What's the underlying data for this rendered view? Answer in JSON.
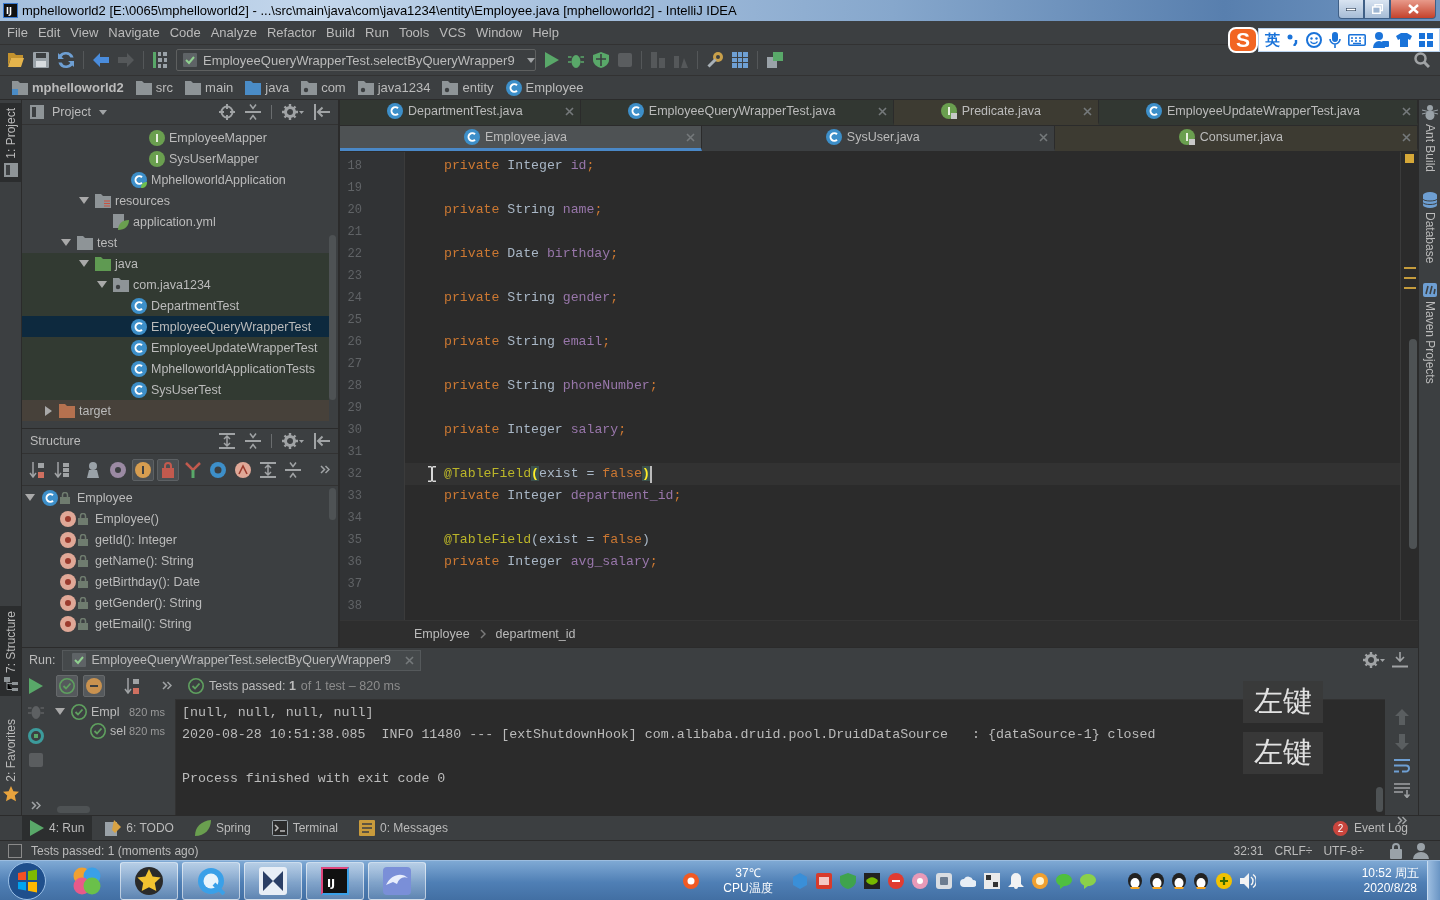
{
  "title_bar": {
    "app_icon": "IJ",
    "title": "mphelloworld2 [E:\\0065\\mphelloworld2] - ...\\src\\main\\java\\com\\java1234\\entity\\Employee.java [mphelloworld2] - IntelliJ IDEA"
  },
  "menu": [
    "File",
    "Edit",
    "View",
    "Navigate",
    "Code",
    "Analyze",
    "Refactor",
    "Build",
    "Run",
    "Tools",
    "VCS",
    "Window",
    "Help"
  ],
  "ime_bar": {
    "logo": "S",
    "mode": "英"
  },
  "toolbar": {
    "run_configuration": "EmployeeQueryWrapperTest.selectByQueryWrapper9"
  },
  "navigation_bar": [
    {
      "label": "mphelloworld2",
      "kind": "project"
    },
    {
      "label": "src",
      "kind": "folder"
    },
    {
      "label": "main",
      "kind": "folder"
    },
    {
      "label": "java",
      "kind": "source_root"
    },
    {
      "label": "com",
      "kind": "package"
    },
    {
      "label": "java1234",
      "kind": "package"
    },
    {
      "label": "entity",
      "kind": "package"
    },
    {
      "label": "Employee",
      "kind": "class"
    }
  ],
  "left_stripe": {
    "top": [
      {
        "label": "1: Project",
        "kind": "project",
        "selected": true
      }
    ],
    "bottom": [
      {
        "label": "7: Structure",
        "kind": "structure",
        "selected": true
      },
      {
        "label": "2: Favorites",
        "kind": "favorites",
        "selected": false
      }
    ]
  },
  "right_stripe": [
    {
      "label": "Ant Build",
      "kind": "ant"
    },
    {
      "label": "Database",
      "kind": "database"
    },
    {
      "label": "Maven Projects",
      "kind": "maven"
    }
  ],
  "project_panel": {
    "title": "Project",
    "tree": [
      {
        "children": [
          {
            "children": [
              {
                "children": [
                  {
                    "children": [
                      {
                        "children": [
                          {
                            "label": "EmployeeMapper",
                            "kind": "interface",
                            "selected": false
                          },
                          {
                            "label": "SysUserMapper",
                            "kind": "interface",
                            "selected": false
                          }
                        ]
                      },
                      {
                        "label": "MphelloworldApplication",
                        "kind": "spring_class",
                        "selected": false
                      }
                    ]
                  }
                ]
              },
              {
                "label": "resources",
                "kind": "resources_folder",
                "expanded": true,
                "selected": false,
                "children": [
                  {
                    "label": "application.yml",
                    "kind": "yml",
                    "selected": false
                  }
                ]
              }
            ]
          },
          {
            "label": "test",
            "kind": "folder",
            "expanded": true,
            "selected": false,
            "children": [
              {
                "label": "java",
                "kind": "test_root",
                "expanded": true,
                "selected": false,
                "children": [
                  {
                    "label": "com.java1234",
                    "kind": "package",
                    "expanded": true,
                    "selected": false,
                    "children": [
                      {
                        "label": "DepartmentTest",
                        "kind": "test_class",
                        "selected": false
                      },
                      {
                        "label": "EmployeeQueryWrapperTest",
                        "kind": "test_class",
                        "selected": true
                      },
                      {
                        "label": "EmployeeUpdateWrapperTest",
                        "kind": "test_class",
                        "selected": false
                      },
                      {
                        "label": "MphelloworldApplicationTests",
                        "kind": "test_class",
                        "selected": false
                      },
                      {
                        "label": "SysUserTest",
                        "kind": "test_class",
                        "selected": false
                      }
                    ]
                  }
                ]
              }
            ]
          }
        ]
      },
      {
        "label": "target",
        "kind": "excluded_folder",
        "expanded": false,
        "selected": false
      }
    ]
  },
  "structure_panel": {
    "title": "Structure",
    "toolbar": [
      {
        "kind": "sort_alpha",
        "pressed": false
      },
      {
        "kind": "sort_visibility",
        "pressed": false
      },
      {
        "kind": "inherited",
        "pressed": false
      },
      {
        "kind": "properties",
        "pressed": false
      },
      {
        "kind": "fields",
        "pressed": true
      },
      {
        "kind": "non_public",
        "pressed": true
      },
      {
        "kind": "lambdas",
        "pressed": false
      },
      {
        "kind": "anonymous",
        "pressed": false
      },
      {
        "kind": "abstract",
        "pressed": false
      },
      {
        "kind": "expand_all",
        "pressed": false
      },
      {
        "kind": "collapse_all",
        "pressed": false
      }
    ],
    "tree": [
      {
        "label": "Employee",
        "kind": "class",
        "expanded": true,
        "selected": false,
        "children": [
          {
            "label": "Employee()",
            "kind": "method",
            "selected": false
          },
          {
            "label": "getId(): Integer",
            "kind": "method",
            "selected": false
          },
          {
            "label": "getName(): String",
            "kind": "method",
            "selected": false
          },
          {
            "label": "getBirthday(): Date",
            "kind": "method",
            "selected": false
          },
          {
            "label": "getGender(): String",
            "kind": "method",
            "selected": false
          },
          {
            "label": "getEmail(): String",
            "kind": "method",
            "selected": false
          }
        ]
      }
    ]
  },
  "editor": {
    "tab_rows": [
      [
        {
          "label": "DepartmentTest.java",
          "kind": "test_class",
          "selected": false
        },
        {
          "label": "EmployeeQueryWrapperTest.java",
          "kind": "test_class",
          "selected": false
        },
        {
          "label": "Predicate.java",
          "kind": "library_interface",
          "selected": false
        },
        {
          "label": "EmployeeUpdateWrapperTest.java",
          "kind": "test_class",
          "selected": false
        }
      ],
      [
        {
          "label": "Employee.java",
          "kind": "class",
          "selected": true
        },
        {
          "label": "SysUser.java",
          "kind": "class",
          "selected": false
        },
        {
          "label": "Consumer.java",
          "kind": "library_interface",
          "selected": false
        }
      ]
    ],
    "lines": [
      {
        "number": "18",
        "current": false,
        "tokens": [
          {
            "kind": "keyword",
            "text": "private"
          },
          {
            "kind": "plain",
            "text": " Integer "
          },
          {
            "kind": "field",
            "text": "id"
          },
          {
            "kind": "keyword",
            "text": ";"
          }
        ]
      },
      {
        "number": "19",
        "current": false
      },
      {
        "number": "20",
        "current": false,
        "tokens": [
          {
            "kind": "keyword",
            "text": "private"
          },
          {
            "kind": "plain",
            "text": " String "
          },
          {
            "kind": "field",
            "text": "name"
          },
          {
            "kind": "keyword",
            "text": ";"
          }
        ]
      },
      {
        "number": "21",
        "current": false
      },
      {
        "number": "22",
        "current": false,
        "tokens": [
          {
            "kind": "keyword",
            "text": "private"
          },
          {
            "kind": "plain",
            "text": " Date "
          },
          {
            "kind": "field",
            "text": "birthday"
          },
          {
            "kind": "keyword",
            "text": ";"
          }
        ]
      },
      {
        "number": "23",
        "current": false
      },
      {
        "number": "24",
        "current": false,
        "tokens": [
          {
            "kind": "keyword",
            "text": "private"
          },
          {
            "kind": "plain",
            "text": " String "
          },
          {
            "kind": "field",
            "text": "gender"
          },
          {
            "kind": "keyword",
            "text": ";"
          }
        ]
      },
      {
        "number": "25",
        "current": false
      },
      {
        "number": "26",
        "current": false,
        "tokens": [
          {
            "kind": "keyword",
            "text": "private"
          },
          {
            "kind": "plain",
            "text": " String "
          },
          {
            "kind": "field",
            "text": "email"
          },
          {
            "kind": "keyword",
            "text": ";"
          }
        ]
      },
      {
        "number": "27",
        "current": false
      },
      {
        "number": "28",
        "current": false,
        "tokens": [
          {
            "kind": "keyword",
            "text": "private"
          },
          {
            "kind": "plain",
            "text": " String "
          },
          {
            "kind": "field",
            "text": "phoneNumber"
          },
          {
            "kind": "keyword",
            "text": ";"
          }
        ]
      },
      {
        "number": "29",
        "current": false
      },
      {
        "number": "30",
        "current": false,
        "tokens": [
          {
            "kind": "keyword",
            "text": "private"
          },
          {
            "kind": "plain",
            "text": " Integer "
          },
          {
            "kind": "field",
            "text": "salary"
          },
          {
            "kind": "keyword",
            "text": ";"
          }
        ]
      },
      {
        "number": "31",
        "current": false
      },
      {
        "number": "32",
        "current": true,
        "tokens": [
          {
            "kind": "annotation",
            "text": "@TableField"
          },
          {
            "kind": "brace_match",
            "text": "("
          },
          {
            "kind": "plain",
            "text": "exist = "
          },
          {
            "kind": "keyword",
            "text": "false"
          },
          {
            "kind": "brace_match",
            "text": ")"
          }
        ]
      },
      {
        "number": "33",
        "current": false,
        "tokens": [
          {
            "kind": "keyword",
            "text": "private"
          },
          {
            "kind": "plain",
            "text": " Integer "
          },
          {
            "kind": "field",
            "text": "department_id"
          },
          {
            "kind": "keyword",
            "text": ";"
          }
        ]
      },
      {
        "number": "34",
        "current": false
      },
      {
        "number": "35",
        "current": false,
        "tokens": [
          {
            "kind": "annotation",
            "text": "@TableField"
          },
          {
            "kind": "plain",
            "text": "(exist = "
          },
          {
            "kind": "keyword",
            "text": "false"
          },
          {
            "kind": "plain",
            "text": ")"
          }
        ]
      },
      {
        "number": "36",
        "current": false,
        "tokens": [
          {
            "kind": "keyword",
            "text": "private"
          },
          {
            "kind": "plain",
            "text": " Integer "
          },
          {
            "kind": "field",
            "text": "avg_salary"
          },
          {
            "kind": "keyword",
            "text": ";"
          }
        ]
      },
      {
        "number": "37",
        "current": false
      },
      {
        "number": "38",
        "current": false
      }
    ],
    "breadcrumb": [
      "Employee",
      "department_id"
    ]
  },
  "run_panel": {
    "label": "Run:",
    "tab": "EmployeeQueryWrapperTest.selectByQueryWrapper9",
    "filters": [
      {
        "kind": "passed",
        "pressed": true
      },
      {
        "kind": "ignored",
        "pressed": true
      }
    ],
    "summary": "Tests passed: **1**",
    "summary_detail": "of 1 test – 820 ms",
    "tests": [
      {
        "label": "Empl",
        "time": "820 ms",
        "kind": "passed",
        "expanded": true,
        "selected": false,
        "children": [
          {
            "label": "sel",
            "time": "820 ms",
            "kind": "passed",
            "selected": false
          }
        ]
      }
    ],
    "console": [
      {
        "kind": "output",
        "text": "[null, null, null, null]"
      },
      {
        "kind": "output",
        "text": "2020-08-28 10:51:38.085  INFO 11480 --- [extShutdownHook] com.alibaba.druid.pool.DruidDataSource   : {dataSource-1} closed"
      },
      {
        "kind": "blank"
      },
      {
        "kind": "output",
        "text": "Process finished with exit code 0"
      }
    ],
    "key_overlays": [
      "左键",
      "左键"
    ]
  },
  "bottom_bar": {
    "tools": [
      {
        "label": "4: Run",
        "kind": "run",
        "selected": true
      },
      {
        "label": "6: TODO",
        "kind": "todo",
        "selected": false
      },
      {
        "label": "Spring",
        "kind": "spring",
        "selected": false
      },
      {
        "label": "Terminal",
        "kind": "terminal",
        "selected": false
      },
      {
        "label": "0: Messages",
        "kind": "messages",
        "selected": false
      }
    ],
    "event_log": {
      "label": "Event Log",
      "count": "2"
    }
  },
  "status_bar": {
    "message": "Tests passed: 1 (moments ago)",
    "position": "32:31",
    "line_separator": "CRLF÷",
    "encoding": "UTF-8÷"
  },
  "taskbar": {
    "apps": [
      {
        "kind": "colorful",
        "running": false
      },
      {
        "kind": "star",
        "running": true
      },
      {
        "kind": "browser",
        "running": true
      },
      {
        "kind": "bowtie",
        "running": true
      },
      {
        "kind": "intellij",
        "running": true,
        "label": "IJ"
      },
      {
        "kind": "dolphin",
        "running": true
      }
    ],
    "temperature": "37℃",
    "temperature_label": "CPU温度",
    "time": "10:52 周五",
    "date": "2020/8/28"
  }
}
